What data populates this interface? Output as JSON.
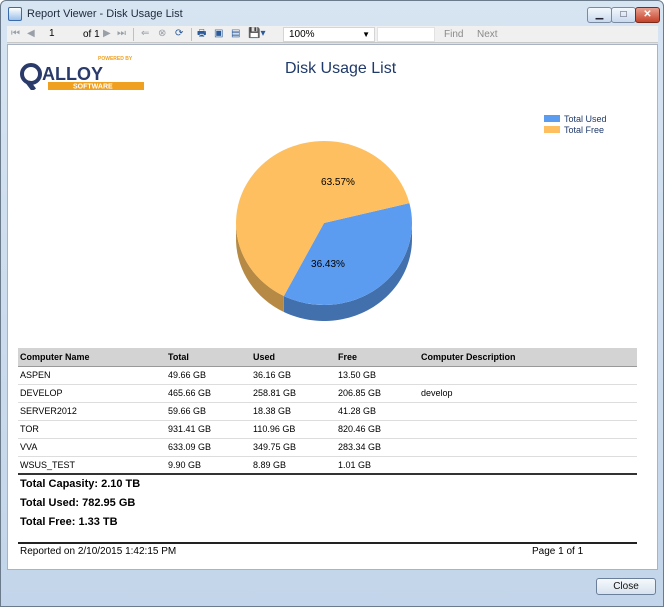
{
  "window": {
    "title": "Report Viewer - Disk Usage List",
    "minimize_glyph": "▁",
    "maximize_glyph": "□",
    "close_glyph": "✕"
  },
  "toolbar": {
    "page_current": "1",
    "page_of": "of 1",
    "zoom": "100%",
    "find_label": "Find",
    "next_label": "Next"
  },
  "logo": {
    "powered_by": "POWERED BY",
    "brand": "ALLOY",
    "sub": "SOFTWARE"
  },
  "report": {
    "title": "Disk Usage List"
  },
  "chart_data": {
    "type": "pie",
    "slices": [
      {
        "label": "Total Used",
        "value": 36.43,
        "text": "36.43%",
        "color": "#5b9bf0"
      },
      {
        "label": "Total Free",
        "value": 63.57,
        "text": "63.57%",
        "color": "#fdbf5f"
      }
    ]
  },
  "table": {
    "columns": [
      "Computer Name",
      "Total",
      "Used",
      "Free",
      "Computer Description"
    ],
    "rows": [
      [
        "ASPEN",
        "49.66 GB",
        "36.16 GB",
        "13.50 GB",
        ""
      ],
      [
        "DEVELOP",
        "465.66 GB",
        "258.81 GB",
        "206.85 GB",
        "develop"
      ],
      [
        "SERVER2012",
        "59.66 GB",
        "18.38 GB",
        "41.28 GB",
        ""
      ],
      [
        "TOR",
        "931.41 GB",
        "110.96 GB",
        "820.46 GB",
        ""
      ],
      [
        "VVA",
        "633.09 GB",
        "349.75 GB",
        "283.34 GB",
        ""
      ],
      [
        "WSUS_TEST",
        "9.90 GB",
        "8.89 GB",
        "1.01 GB",
        ""
      ]
    ]
  },
  "totals": {
    "capacity": "Total Capasity: 2.10 TB",
    "used": "Total Used: 782.95 GB",
    "free": "Total Free: 1.33 TB"
  },
  "footer": {
    "reported_on": "Reported on 2/10/2015 1:42:15 PM",
    "page": "Page 1 of 1"
  },
  "dialog": {
    "close_label": "Close"
  }
}
